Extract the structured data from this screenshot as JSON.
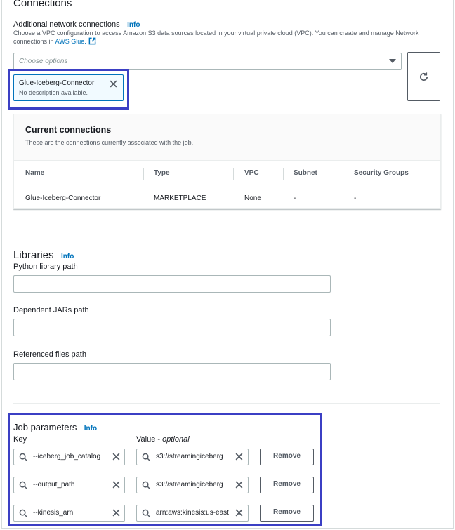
{
  "connections": {
    "title": "Connections",
    "network_label": "Additional network connections",
    "info": "Info",
    "description_text": "Choose a VPC configuration to access Amazon S3 data sources located in your virtual private cloud (VPC). You can create and manage Network connections in",
    "description_link": "AWS Glue.",
    "select_placeholder": "Choose options",
    "token": {
      "name": "Glue-Iceberg-Connector",
      "description": "No description available."
    }
  },
  "current_connections": {
    "title": "Current connections",
    "subtitle": "These are the connections currently associated with the job.",
    "columns": [
      "Name",
      "Type",
      "VPC",
      "Subnet",
      "Security Groups"
    ],
    "rows": [
      [
        "Glue-Iceberg-Connector",
        "MARKETPLACE",
        "None",
        "-",
        "-"
      ]
    ]
  },
  "libraries": {
    "title": "Libraries",
    "info": "Info",
    "python_label": "Python library path",
    "python_value": "",
    "jars_label": "Dependent JARs path",
    "jars_value": "",
    "files_label": "Referenced files path",
    "files_value": ""
  },
  "job_parameters": {
    "title": "Job parameters",
    "info": "Info",
    "key_label": "Key",
    "value_label": "Value",
    "value_optional": "optional",
    "remove_label": "Remove",
    "rows": [
      {
        "key": "--iceberg_job_catalog",
        "value": "s3://streamingiceberg"
      },
      {
        "key": "--output_path",
        "value": "s3://streamingiceberg"
      },
      {
        "key": "--kinesis_arn",
        "value": "arn:aws:kinesis:us-east"
      }
    ]
  },
  "colors": {
    "link": "#0073bb",
    "highlight": "#3b3fc4",
    "text": "#16191f",
    "muted": "#545b64"
  },
  "icons": [
    "external-link-icon",
    "refresh-icon",
    "close-icon",
    "chevron-down-icon",
    "search-icon"
  ]
}
